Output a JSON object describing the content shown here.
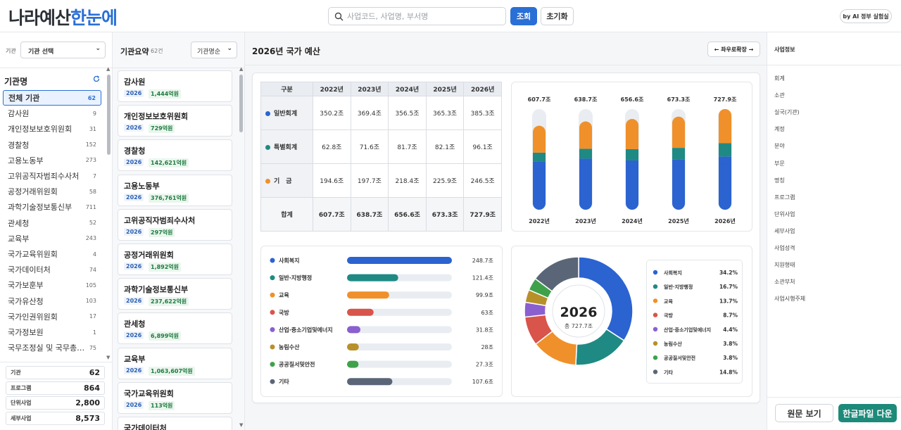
{
  "header": {
    "logo_part1": "나라예산",
    "logo_part2": "한눈에",
    "search_placeholder": "사업코드, 사업명, 부서명",
    "search_button": "조회",
    "reset_button": "초기화",
    "badge": "by AI 정부 실험실"
  },
  "sidebar": {
    "filter_label": "기관",
    "filter_value": "기관 선택",
    "section_title": "기관명",
    "agencies": [
      {
        "name": "전체 기관",
        "count": "62"
      },
      {
        "name": "감사원",
        "count": "9"
      },
      {
        "name": "개인정보보호위원회",
        "count": "31"
      },
      {
        "name": "경찰청",
        "count": "152"
      },
      {
        "name": "고용노동부",
        "count": "273"
      },
      {
        "name": "고위공직자범죄수사처",
        "count": "7"
      },
      {
        "name": "공정거래위원회",
        "count": "58"
      },
      {
        "name": "과학기술정보통신부",
        "count": "711"
      },
      {
        "name": "관세청",
        "count": "52"
      },
      {
        "name": "교육부",
        "count": "243"
      },
      {
        "name": "국가교육위원회",
        "count": "4"
      },
      {
        "name": "국가데이터처",
        "count": "74"
      },
      {
        "name": "국가보훈부",
        "count": "105"
      },
      {
        "name": "국가유산청",
        "count": "103"
      },
      {
        "name": "국가인권위원회",
        "count": "17"
      },
      {
        "name": "국가정보원",
        "count": "1"
      },
      {
        "name": "국무조정실 및 국무총…",
        "count": "75"
      }
    ],
    "stats": [
      {
        "label": "기관",
        "value": "62"
      },
      {
        "label": "프로그램",
        "value": "864"
      },
      {
        "label": "단위사업",
        "value": "2,800"
      },
      {
        "label": "세부사업",
        "value": "8,573"
      }
    ]
  },
  "summary": {
    "title": "기관요약",
    "count": "62건",
    "sort_value": "기관명순",
    "cards": [
      {
        "name": "감사원",
        "year": "2026",
        "amount": "1,444억원"
      },
      {
        "name": "개인정보보호위원회",
        "year": "2026",
        "amount": "729억원"
      },
      {
        "name": "경찰청",
        "year": "2026",
        "amount": "142,621억원"
      },
      {
        "name": "고용노동부",
        "year": "2026",
        "amount": "376,761억원"
      },
      {
        "name": "고위공직자범죄수사처",
        "year": "2026",
        "amount": "297억원"
      },
      {
        "name": "공정거래위원회",
        "year": "2026",
        "amount": "1,892억원"
      },
      {
        "name": "과학기술정보통신부",
        "year": "2026",
        "amount": "237,622억원"
      },
      {
        "name": "관세청",
        "year": "2026",
        "amount": "6,899억원"
      },
      {
        "name": "교육부",
        "year": "2026",
        "amount": "1,063,607억원"
      },
      {
        "name": "국가교육위원회",
        "year": "2026",
        "amount": "113억원"
      },
      {
        "name": "국가데이터처",
        "year": "",
        "amount": ""
      }
    ]
  },
  "main": {
    "title": "2026년 국가 예산",
    "expand_button": "← 좌우로확장 →",
    "table": {
      "headers": [
        "구분",
        "2022년",
        "2023년",
        "2024년",
        "2025년",
        "2026년"
      ],
      "rows": [
        {
          "label": "일반회계",
          "color": "#2b63d0",
          "values": [
            "350.2조",
            "369.4조",
            "356.5조",
            "365.3조",
            "385.3조"
          ]
        },
        {
          "label": "특별회계",
          "color": "#1f8a84",
          "values": [
            "62.8조",
            "71.6조",
            "81.7조",
            "82.1조",
            "96.1조"
          ]
        },
        {
          "label": "기　금",
          "color": "#f0902a",
          "values": [
            "194.6조",
            "197.7조",
            "218.4조",
            "225.9조",
            "246.5조"
          ]
        }
      ],
      "total_label": "합계",
      "totals": [
        "607.7조",
        "638.7조",
        "656.6조",
        "673.3조",
        "727.9조"
      ]
    }
  },
  "chart_data": [
    {
      "type": "bar",
      "categories": [
        "2022년",
        "2023년",
        "2024년",
        "2025년",
        "2026년"
      ],
      "series": [
        {
          "name": "일반회계",
          "values": [
            350.2,
            369.4,
            356.5,
            365.3,
            385.3
          ],
          "color": "#2b63d0"
        },
        {
          "name": "특별회계",
          "values": [
            62.8,
            71.6,
            81.7,
            82.1,
            96.1
          ],
          "color": "#1f8a84"
        },
        {
          "name": "기 금",
          "values": [
            194.6,
            197.7,
            218.4,
            225.9,
            246.5
          ],
          "color": "#f0902a"
        }
      ],
      "totals_labels": [
        "607.7조",
        "638.7조",
        "656.6조",
        "673.3조",
        "727.9조"
      ],
      "ylim": [
        0,
        727.9
      ],
      "stacked": true
    },
    {
      "type": "bar",
      "orientation": "horizontal",
      "categories": [
        "사회복지",
        "일반·지방행정",
        "교육",
        "국방",
        "산업·중소기업및에너지",
        "농림수산",
        "공공질서및안전",
        "기타"
      ],
      "values": [
        248.7,
        121.4,
        99.9,
        63,
        31.8,
        28,
        27.3,
        107.6
      ],
      "value_labels": [
        "248.7조",
        "121.4조",
        "99.9조",
        "63조",
        "31.8조",
        "28조",
        "27.3조",
        "107.6조"
      ],
      "colors": [
        "#2b63d0",
        "#1f8a84",
        "#f0902a",
        "#d9544a",
        "#8a5fd0",
        "#b8902a",
        "#3fa24a",
        "#5a6678"
      ],
      "xlim": [
        0,
        248.7
      ]
    },
    {
      "type": "pie",
      "center_title": "2026",
      "center_subtitle": "총 727.7조",
      "categories": [
        "사회복지",
        "일반·지방행정",
        "교육",
        "국방",
        "산업·중소기업및에너지",
        "농림수산",
        "공공질서및안전",
        "기타"
      ],
      "values": [
        34.2,
        16.7,
        13.7,
        8.7,
        4.4,
        3.8,
        3.8,
        14.8
      ],
      "value_labels": [
        "34.2%",
        "16.7%",
        "13.7%",
        "8.7%",
        "4.4%",
        "3.8%",
        "3.8%",
        "14.8%"
      ],
      "colors": [
        "#2b63d0",
        "#1f8a84",
        "#f0902a",
        "#d9544a",
        "#8a5fd0",
        "#b8902a",
        "#3fa24a",
        "#5a6678"
      ],
      "legend": "right"
    }
  ],
  "info": {
    "title": "사업정보",
    "items": [
      "회계",
      "소관",
      "실국(기관)",
      "계정",
      "분야",
      "부문",
      "명칭",
      "프로그램",
      "단위사업",
      "세부사업",
      "사업성격",
      "지원형태",
      "소관부처",
      "사업시행주체"
    ],
    "view_button": "원문 보기",
    "download_button": "한글파일 다운"
  }
}
